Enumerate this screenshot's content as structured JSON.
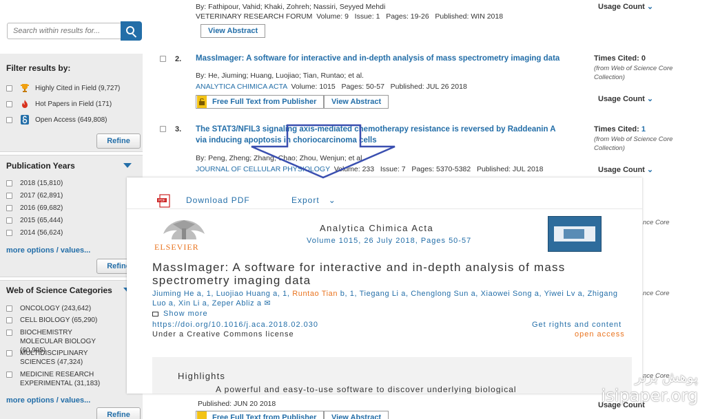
{
  "sidebar": {
    "search_placeholder": "Search within results for...",
    "filter_title": "Filter results by:",
    "filters": [
      {
        "label": "Highly Cited in Field (9,727)",
        "icon": "trophy-icon"
      },
      {
        "label": "Hot Papers in Field (171)",
        "icon": "flame-icon"
      },
      {
        "label": "Open Access (649,808)",
        "icon": "open-access-lock-icon"
      }
    ],
    "refine_label": "Refine",
    "pub_years_title": "Publication Years",
    "years": [
      "2018 (15,810)",
      "2017 (62,891)",
      "2016 (69,682)",
      "2015 (65,444)",
      "2014 (56,624)"
    ],
    "more_options": "more options / values...",
    "wos_title": "Web of Science Categories",
    "categories": [
      {
        "label": "ONCOLOGY (243,642)"
      },
      {
        "label": "CELL BIOLOGY (65,290)"
      },
      {
        "label": "BIOCHEMISTRY MOLECULAR BIOLOGY (60,995)"
      },
      {
        "label": "MULTIDISCIPLINARY SCIENCES (47,324)"
      },
      {
        "label": "MEDICINE RESEARCH EXPERIMENTAL (31,183)"
      }
    ]
  },
  "results": {
    "r1": {
      "authors": "By: Fathipour, Vahid; Khaki, Zohreh; Nassiri, Seyyed Mehdi",
      "journal": "VETERINARY RESEARCH FORUM",
      "meta": "  Volume: 9   Issue: 1   Pages: 19-26   Published: WIN 2018",
      "view_abstract": "View Abstract",
      "usage": "Usage Count"
    },
    "r2": {
      "num": "2.",
      "title": "MassImager: A software for interactive and in-depth analysis of mass spectrometry imaging data",
      "authors": "By: He, Jiuming; Huang, Luojiao; Tian, Runtao; et al.",
      "journal": "ANALYTICA CHIMICA ACTA",
      "meta": "  Volume: 1015   Pages: 50-57   Published: JUL 26 2018",
      "free_text": "Free Full Text from Publisher",
      "view_abstract": "View Abstract",
      "cited_label": "Times Cited: ",
      "cited_value": "0",
      "cited_sub": "(from Web of Science Core Collection)",
      "usage": "Usage Count"
    },
    "r3": {
      "num": "3.",
      "title": "The STAT3/NFIL3 signaling axis-mediated chemotherapy resistance is reversed by Raddeanin A via inducing apoptosis in choriocarcinoma cells",
      "authors": "By: Peng, Zheng; Zhang, Chao; Zhou, Wenjun; et al.",
      "journal": "JOURNAL OF CELLULAR PHYSIOLOGY",
      "meta": "  Volume: 233   Issue: 7   Pages: 5370-5382   Published: JUL 2018",
      "cited_label": "Times Cited: ",
      "cited_value": "1",
      "cited_sub": "(from Web of Science Core Collection)",
      "usage": "Usage Count"
    },
    "hidden_core": "nce Core",
    "last_published": "Published: JUN 20 2018",
    "last_free_text": "Free Full Text from Publisher",
    "last_view_abstract": "View Abstract"
  },
  "overlay": {
    "download_pdf": "Download PDF",
    "export": "Export",
    "journal": "Analytica Chimica Acta",
    "volume": "Volume 1015, 26 July 2018, Pages 50-57",
    "publisher_logo": "ELSEVIER",
    "title": "MassImager: A software for interactive and in-depth analysis of mass spectrometry imaging data",
    "authors_pre": "Jiuming He a, 1, Luojiao Huang a, 1, ",
    "author_highlight": "Runtao Tian",
    "authors_post": " b, 1, Tiegang Li a, Chenglong Sun a, Xiaowei Song a, Yiwei Lv a, Zhigang Luo a, Xin Li a, Zeper Abliz a",
    "show_more": "Show more",
    "doi": "https://doi.org/10.1016/j.aca.2018.02.030",
    "rights": "Get rights and content",
    "license": "Under a Creative Commons license",
    "open_access": "open access",
    "highlights_title": "Highlights",
    "highlight_1": "A powerful and easy-to-use software to discover underlying biological"
  },
  "watermark": {
    "line1": "پوهش برتر",
    "line2": "isipaper.org"
  },
  "colors": {
    "link": "#236ea8",
    "accent_orange": "#e9731e",
    "sidebar_bg": "#ececec"
  }
}
